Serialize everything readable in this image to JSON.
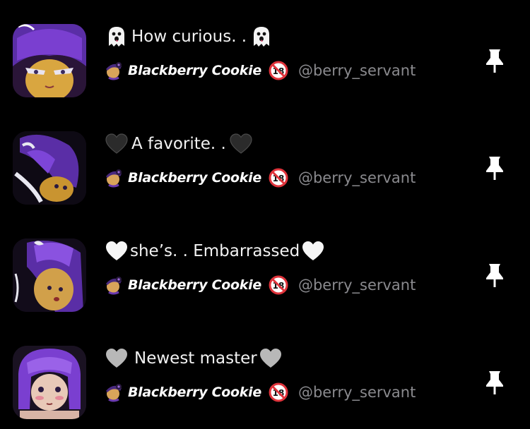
{
  "items": [
    {
      "emoji_left": "ghost-icon",
      "title": "How curious. .",
      "emoji_right": "ghost-icon",
      "author": "Blackberry Cookie",
      "badge": "18",
      "handle": "@berry_servant"
    },
    {
      "emoji_left": "black-heart-icon",
      "title": "A favorite. .",
      "emoji_right": "black-heart-icon",
      "author": "Blackberry Cookie",
      "badge": "18",
      "handle": "@berry_servant"
    },
    {
      "emoji_left": "white-heart-icon",
      "title": "she’s. . Embarrassed",
      "emoji_right": "white-heart-icon",
      "author": "Blackberry Cookie",
      "badge": "18",
      "handle": "@berry_servant"
    },
    {
      "emoji_left": "grey-heart-icon",
      "title": "Newest master",
      "emoji_right": "grey-heart-icon",
      "author": "Blackberry Cookie",
      "badge": "18",
      "handle": "@berry_servant"
    }
  ],
  "colors": {
    "background": "#000000",
    "title_text": "#f2f2f2",
    "author_text": "#ffffff",
    "handle_text": "#8a8a8e",
    "pin": "#ffffff",
    "accent_purple": "#6a2bb8"
  },
  "icons": {
    "pin": "pin-icon",
    "author": "blackberry-cookie-icon",
    "badge": "no-under-18-icon"
  }
}
